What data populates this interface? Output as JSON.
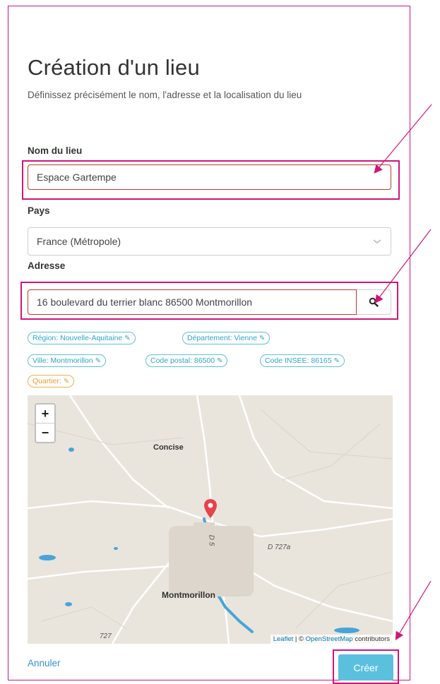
{
  "form": {
    "title": "Création d'un lieu",
    "subtitle": "Définissez précisément le nom, l'adresse et la localisation du lieu",
    "name_label": "Nom du lieu",
    "name_value": "Espace Gartempe",
    "country_label": "Pays",
    "country_value": "France (Métropole)",
    "address_label": "Adresse",
    "address_value": "16 boulevard du terrier blanc 86500 Montmorillon"
  },
  "tags": [
    {
      "label": "Région: Nouvelle-Aquitaine"
    },
    {
      "label": "Département: Vienne"
    },
    {
      "label": "Ville: Montmorillon"
    },
    {
      "label": "Code postal: 86500"
    },
    {
      "label": "Code INSEE: 86165"
    },
    {
      "label": "Quartier:"
    }
  ],
  "map": {
    "zoom_in": "+",
    "zoom_out": "−",
    "places": {
      "concise": "Concise",
      "montmorillon": "Montmorillon"
    },
    "roads": {
      "d5": "D 5",
      "d727a": "D 727a",
      "d727": "727"
    },
    "attribution_leaflet": "Leaflet",
    "attribution_sep": " | © ",
    "attribution_osm": "OpenStreetMap",
    "attribution_suffix": " contributors",
    "colors": {
      "land": "#e9e5dd",
      "water": "#4aa3d8",
      "marker": "#e8424a"
    }
  },
  "actions": {
    "cancel": "Annuler",
    "create": "Créer"
  },
  "colors": {
    "highlight": "#d0157a",
    "info": "#5bc0de",
    "warning": "#f0ad4e",
    "link": "#3a8fc8"
  }
}
